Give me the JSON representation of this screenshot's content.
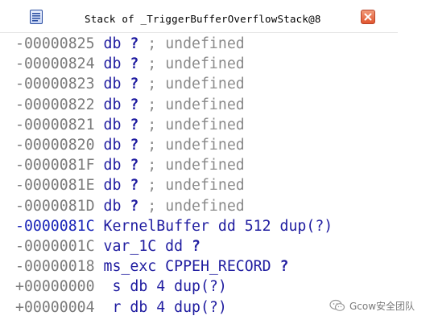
{
  "window": {
    "title": "Stack of _TriggerBufferOverflowStack@8"
  },
  "lines": [
    {
      "addr": "-00000825",
      "name": "",
      "op": "db",
      "arg": "?",
      "sep": ";",
      "comment": "undefined",
      "hl": false
    },
    {
      "addr": "-00000824",
      "name": "",
      "op": "db",
      "arg": "?",
      "sep": ";",
      "comment": "undefined",
      "hl": false
    },
    {
      "addr": "-00000823",
      "name": "",
      "op": "db",
      "arg": "?",
      "sep": ";",
      "comment": "undefined",
      "hl": false
    },
    {
      "addr": "-00000822",
      "name": "",
      "op": "db",
      "arg": "?",
      "sep": ";",
      "comment": "undefined",
      "hl": false
    },
    {
      "addr": "-00000821",
      "name": "",
      "op": "db",
      "arg": "?",
      "sep": ";",
      "comment": "undefined",
      "hl": false
    },
    {
      "addr": "-00000820",
      "name": "",
      "op": "db",
      "arg": "?",
      "sep": ";",
      "comment": "undefined",
      "hl": false
    },
    {
      "addr": "-0000081F",
      "name": "",
      "op": "db",
      "arg": "?",
      "sep": ";",
      "comment": "undefined",
      "hl": false
    },
    {
      "addr": "-0000081E",
      "name": "",
      "op": "db",
      "arg": "?",
      "sep": ";",
      "comment": "undefined",
      "hl": false
    },
    {
      "addr": "-0000081D",
      "name": "",
      "op": "db",
      "arg": "?",
      "sep": ";",
      "comment": "undefined",
      "hl": false
    },
    {
      "addr": "-0000081C",
      "name": "KernelBuffer",
      "op": "dd",
      "arg": "512 dup(?)",
      "sep": "",
      "comment": "",
      "hl": true
    },
    {
      "addr": "-0000001C",
      "name": "var_1C",
      "op": "dd",
      "arg": "?",
      "sep": "",
      "comment": "",
      "hl": false
    },
    {
      "addr": "-00000018",
      "name": "ms_exc",
      "op": "CPPEH_RECORD",
      "arg": "?",
      "sep": "",
      "comment": "",
      "hl": false
    },
    {
      "addr": "+00000000",
      "name": " s",
      "op": "db",
      "arg": "4 dup(?)",
      "sep": "",
      "comment": "",
      "hl": false
    },
    {
      "addr": "+00000004",
      "name": " r",
      "op": "db",
      "arg": "4 dup(?)",
      "sep": "",
      "comment": "",
      "hl": false
    }
  ],
  "watermark": {
    "text": "Gcow安全团队"
  },
  "colors": {
    "address": "#7a7a7a",
    "highlight_address": "#1a25b8",
    "keyword": "#1f1ca0",
    "comment": "#8a8a8a"
  }
}
